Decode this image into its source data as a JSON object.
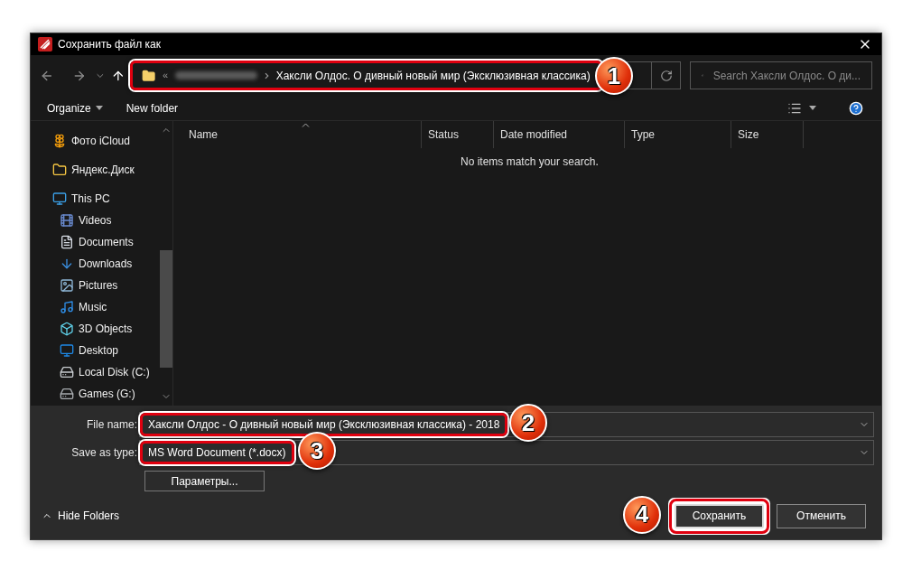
{
  "window": {
    "title": "Сохранить файл как"
  },
  "address": {
    "overflow": "«",
    "segments": [
      {
        "kind": "blurred"
      },
      {
        "kind": "text",
        "label": "Хаксли Олдос. О дивный новый мир (Эксклюзивная классика)"
      }
    ],
    "callout": "1"
  },
  "search": {
    "placeholder": "Search Хаксли Олдос. О ди..."
  },
  "toolbar": {
    "organize": "Organize",
    "new_folder": "New folder"
  },
  "sidebar": {
    "items": [
      {
        "label": "Фото iCloud",
        "kind": "photos"
      },
      {
        "label": "Яндекс.Диск",
        "kind": "cloud"
      },
      {
        "label": "This PC",
        "kind": "pc",
        "children": [
          {
            "label": "Videos",
            "kind": "videos"
          },
          {
            "label": "Documents",
            "kind": "documents"
          },
          {
            "label": "Downloads",
            "kind": "downloads"
          },
          {
            "label": "Pictures",
            "kind": "pictures"
          },
          {
            "label": "Music",
            "kind": "music"
          },
          {
            "label": "3D Objects",
            "kind": "objects"
          },
          {
            "label": "Desktop",
            "kind": "desktop"
          },
          {
            "label": "Local Disk (C:)",
            "kind": "system-disk"
          },
          {
            "label": "Games (G:)",
            "kind": "disk"
          }
        ]
      }
    ]
  },
  "table": {
    "columns": [
      {
        "label": "Name",
        "sorted": true
      },
      {
        "label": "Status",
        "sorted": false
      },
      {
        "label": "Date modified",
        "sorted": false
      },
      {
        "label": "Type",
        "sorted": false
      },
      {
        "label": "Size",
        "sorted": false
      }
    ],
    "empty_message": "No items match your search."
  },
  "form": {
    "file_name": {
      "label": "File name:",
      "value": "Хаксли Олдос - О дивный новый мир (Эксклюзивная классика) - 2018",
      "callout": "2"
    },
    "save_type": {
      "label": "Save as type:",
      "value": "MS Word Document (*.docx)",
      "callout": "3"
    },
    "options_button": "Параметры..."
  },
  "footer": {
    "hide_folders": "Hide Folders",
    "buttons": [
      {
        "label": "Сохранить",
        "primary": true,
        "callout": "4"
      },
      {
        "label": "Отменить",
        "primary": false
      }
    ]
  }
}
